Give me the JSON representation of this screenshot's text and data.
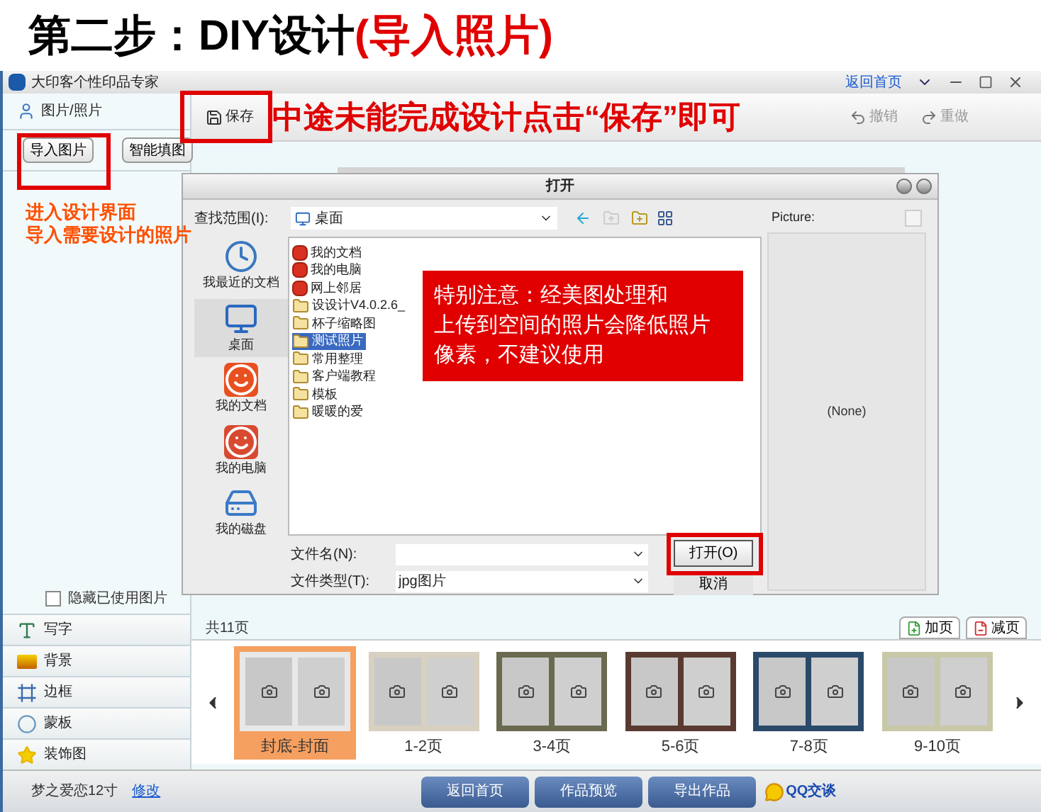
{
  "heading": {
    "prefix": "第二步：DIY设计",
    "highlight": "(导入照片)"
  },
  "window": {
    "title": "大印客个性印品专家",
    "home_link": "返回首页"
  },
  "sidebar": {
    "header": "图片/照片",
    "buttons": [
      "导入图片",
      "智能填图"
    ],
    "hide_used": {
      "label": "隐藏已使用图片",
      "checked": false
    },
    "tools": [
      {
        "label": "写字",
        "kind": "text"
      },
      {
        "label": "背景",
        "kind": "background"
      },
      {
        "label": "边框",
        "kind": "frame"
      },
      {
        "label": "蒙板",
        "kind": "mask"
      },
      {
        "label": "装饰图",
        "kind": "decoration"
      }
    ]
  },
  "toolbar": {
    "save": "保存",
    "undo": "撤销",
    "redo": "重做"
  },
  "pages": {
    "count": "共11页",
    "add": "加页",
    "remove": "减页",
    "thumbnails": [
      {
        "label": "封底-封面",
        "selected": true
      },
      {
        "label": "1-2页",
        "selected": false
      },
      {
        "label": "3-4页",
        "selected": false
      },
      {
        "label": "5-6页",
        "selected": false
      },
      {
        "label": "7-8页",
        "selected": false
      },
      {
        "label": "9-10页",
        "selected": false
      }
    ]
  },
  "status": {
    "product": "梦之爱恋12寸",
    "edit_link": "修改",
    "buttons": [
      "返回首页",
      "作品预览",
      "导出作品"
    ],
    "chat": "QQ交谈"
  },
  "dialog": {
    "title": "打开",
    "look_in_label": "查找范围(I):",
    "look_in": "桌面",
    "places": [
      {
        "label": "我最近的文档",
        "kind": "recent",
        "selected": false
      },
      {
        "label": "桌面",
        "kind": "desktop",
        "selected": true
      },
      {
        "label": "我的文档",
        "kind": "documents",
        "selected": false
      },
      {
        "label": "我的电脑",
        "kind": "computer",
        "selected": false
      },
      {
        "label": "我的磁盘",
        "kind": "disk",
        "selected": false
      }
    ],
    "files": [
      {
        "label": "我的文档",
        "kind": "special",
        "selected": false
      },
      {
        "label": "我的电脑",
        "kind": "special",
        "selected": false
      },
      {
        "label": "网上邻居",
        "kind": "special",
        "selected": false
      },
      {
        "label": "设设计V4.0.2.6_",
        "kind": "folder",
        "selected": false
      },
      {
        "label": "杯子缩略图",
        "kind": "folder",
        "selected": false
      },
      {
        "label": "测试照片",
        "kind": "folder",
        "selected": true
      },
      {
        "label": "常用整理",
        "kind": "folder",
        "selected": false
      },
      {
        "label": "客户端教程",
        "kind": "folder",
        "selected": false
      },
      {
        "label": "模板",
        "kind": "folder",
        "selected": false
      },
      {
        "label": "暖暖的爱",
        "kind": "folder",
        "selected": false
      }
    ],
    "file_name_label": "文件名(N):",
    "file_type_label": "文件类型(T):",
    "file_type": "jpg图片",
    "open": "打开(O)",
    "cancel": "取消",
    "preview_label": "Picture:",
    "preview_empty": "(None)"
  },
  "annotations": {
    "save_note": "中途未能完成设计点击“保存”即可",
    "import_note": [
      "进入设计界面",
      "导入需要设计的照片"
    ],
    "warning_note": [
      "特别注意：经美图处理和",
      "上传到空间的照片会降低照片",
      "像素，不建议使用"
    ]
  }
}
